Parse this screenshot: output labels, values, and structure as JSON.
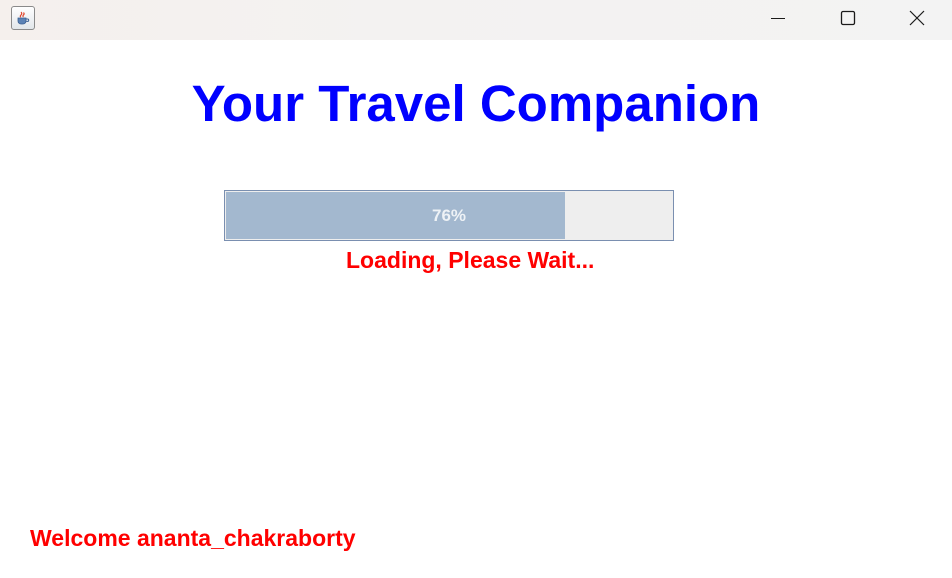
{
  "window": {
    "icon": "java-cup-icon",
    "controls": {
      "minimize_icon": "minimize-icon",
      "maximize_icon": "maximize-icon",
      "close_icon": "close-icon"
    }
  },
  "heading": "Your Travel Companion",
  "progress": {
    "value": 76,
    "label": "76%"
  },
  "status": "Loading, Please Wait...",
  "welcome": "Welcome ananta_chakraborty",
  "colors": {
    "heading": "#0000ff",
    "status": "#ff0000",
    "progress_fill": "#a3b8cf",
    "progress_track": "#eeeeee"
  }
}
